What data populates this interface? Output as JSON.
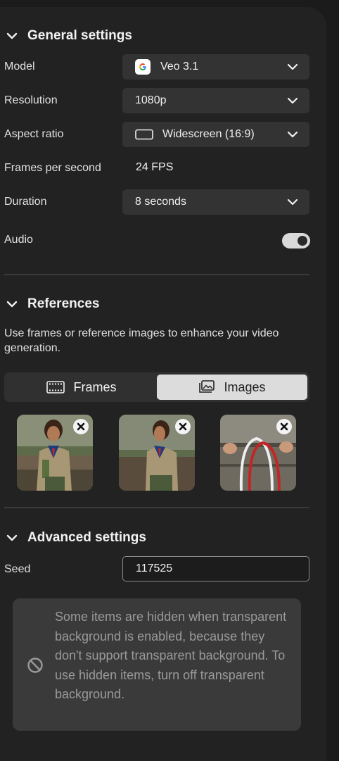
{
  "general": {
    "title": "General settings",
    "model": {
      "label": "Model",
      "value": "Veo 3.1",
      "icon": "google-g-icon"
    },
    "resolution": {
      "label": "Resolution",
      "value": "1080p"
    },
    "aspect": {
      "label": "Aspect ratio",
      "value": "Widescreen (16:9)",
      "icon": "widescreen-icon"
    },
    "fps": {
      "label": "Frames per second",
      "value": "24 FPS"
    },
    "duration": {
      "label": "Duration",
      "value": "8 seconds"
    },
    "audio": {
      "label": "Audio",
      "enabled": true
    }
  },
  "references": {
    "title": "References",
    "description": "Use frames or reference images to enhance your video generation.",
    "tabs": [
      {
        "label": "Frames",
        "icon": "film-strip-icon",
        "selected": false
      },
      {
        "label": "Images",
        "icon": "image-stack-icon",
        "selected": true
      }
    ],
    "images": [
      {
        "subject": "scout-portrait-front"
      },
      {
        "subject": "scout-portrait-side"
      },
      {
        "subject": "rope-knot-hands"
      }
    ]
  },
  "advanced": {
    "title": "Advanced settings",
    "seed": {
      "label": "Seed",
      "value": "117525"
    },
    "notice": "Some items are hidden when transparent background is enabled, because they don't support transparent background. To use hidden items, turn off transparent background."
  },
  "colors": {
    "panel": "#222222",
    "field": "#333333",
    "accent": "#dcdcdc"
  }
}
